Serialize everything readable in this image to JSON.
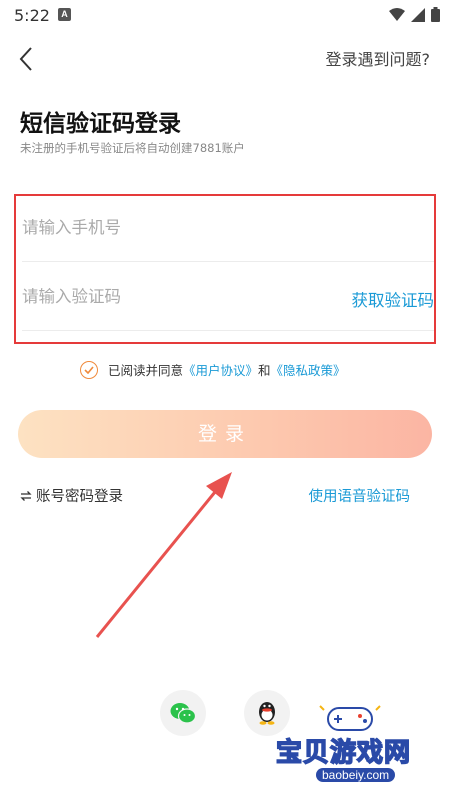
{
  "status_bar": {
    "time": "5:22",
    "notification_letter": "A"
  },
  "header": {
    "help_link": "登录遇到问题?"
  },
  "page": {
    "title": "短信验证码登录",
    "subtitle": "未注册的手机号验证后将自动创建7881账户"
  },
  "form": {
    "phone_placeholder": "请输入手机号",
    "code_placeholder": "请输入验证码",
    "get_code_label": "获取验证码"
  },
  "agreement": {
    "prefix": "已阅读并同意",
    "user_agreement": "《用户协议》",
    "and": "和",
    "privacy_policy": "《隐私政策》"
  },
  "login_button": "登录",
  "alt_login": {
    "password_login": "账号密码登录",
    "voice_code": "使用语音验证码"
  },
  "social": {
    "wechat_icon": "wechat-icon",
    "qq_icon": "qq-icon"
  },
  "watermark": {
    "title": "宝贝游戏网",
    "url": "baobeiy.com"
  },
  "colors": {
    "accent_blue": "#1a9ad6",
    "highlight_red": "#e53a3a",
    "check_orange": "#f08a3c",
    "button_gradient_start": "#fde2c2",
    "button_gradient_end": "#fbb5a3"
  }
}
